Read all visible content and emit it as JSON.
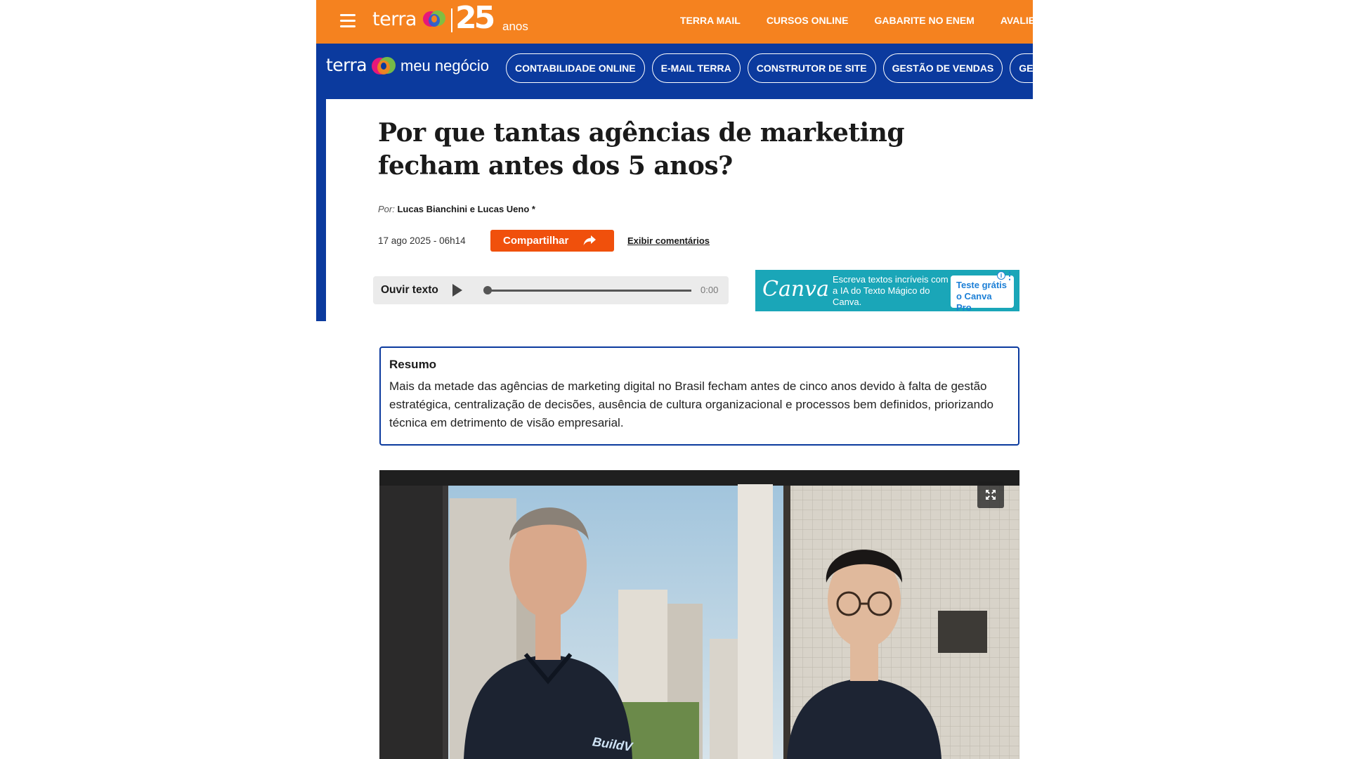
{
  "header": {
    "brand": "terra",
    "anniversary_number": "25",
    "anniversary_word": "anos",
    "nav": [
      "TERRA MAIL",
      "CURSOS ONLINE",
      "GABARITE NO ENEM",
      "AVALIE"
    ]
  },
  "subheader": {
    "brand": "terra",
    "section": "meu negócio",
    "chips": [
      "CONTABILIDADE ONLINE",
      "E-MAIL TERRA",
      "CONSTRUTOR DE SITE",
      "GESTÃO DE VENDAS",
      "GEST"
    ]
  },
  "article": {
    "title": "Por que tantas agências de marketing fecham antes dos 5 anos?",
    "byline_prefix": "Por:",
    "authors": "Lucas Bianchini e Lucas Ueno *",
    "date": "17 ago 2025 - 06h14",
    "share_label": "Compartilhar",
    "comments_label": "Exibir comentários"
  },
  "audio": {
    "label": "Ouvir texto",
    "time": "0:00",
    "progress": 0
  },
  "ad": {
    "brand": "Canva",
    "text": "Escreva textos incríveis com a IA do Texto Mágico do Canva.",
    "cta": "Teste grátis o Canva Pro",
    "info_icon": "i"
  },
  "summary": {
    "title": "Resumo",
    "text": "Mais da metade das agências de marketing digital no Brasil fecham antes de cinco anos devido à falta de gestão estratégica, centralização de decisões, ausência de cultura organizacional e processos bem definidos, priorizando técnica em detrimento de visão empresarial."
  },
  "photo": {
    "shirt_logo": "BuildV",
    "icons": [
      "expand-icon"
    ]
  },
  "colors": {
    "orange": "#f5821f",
    "blue": "#0b3a9e",
    "share": "#f0500c",
    "ad_bg": "#1aa6b8"
  }
}
